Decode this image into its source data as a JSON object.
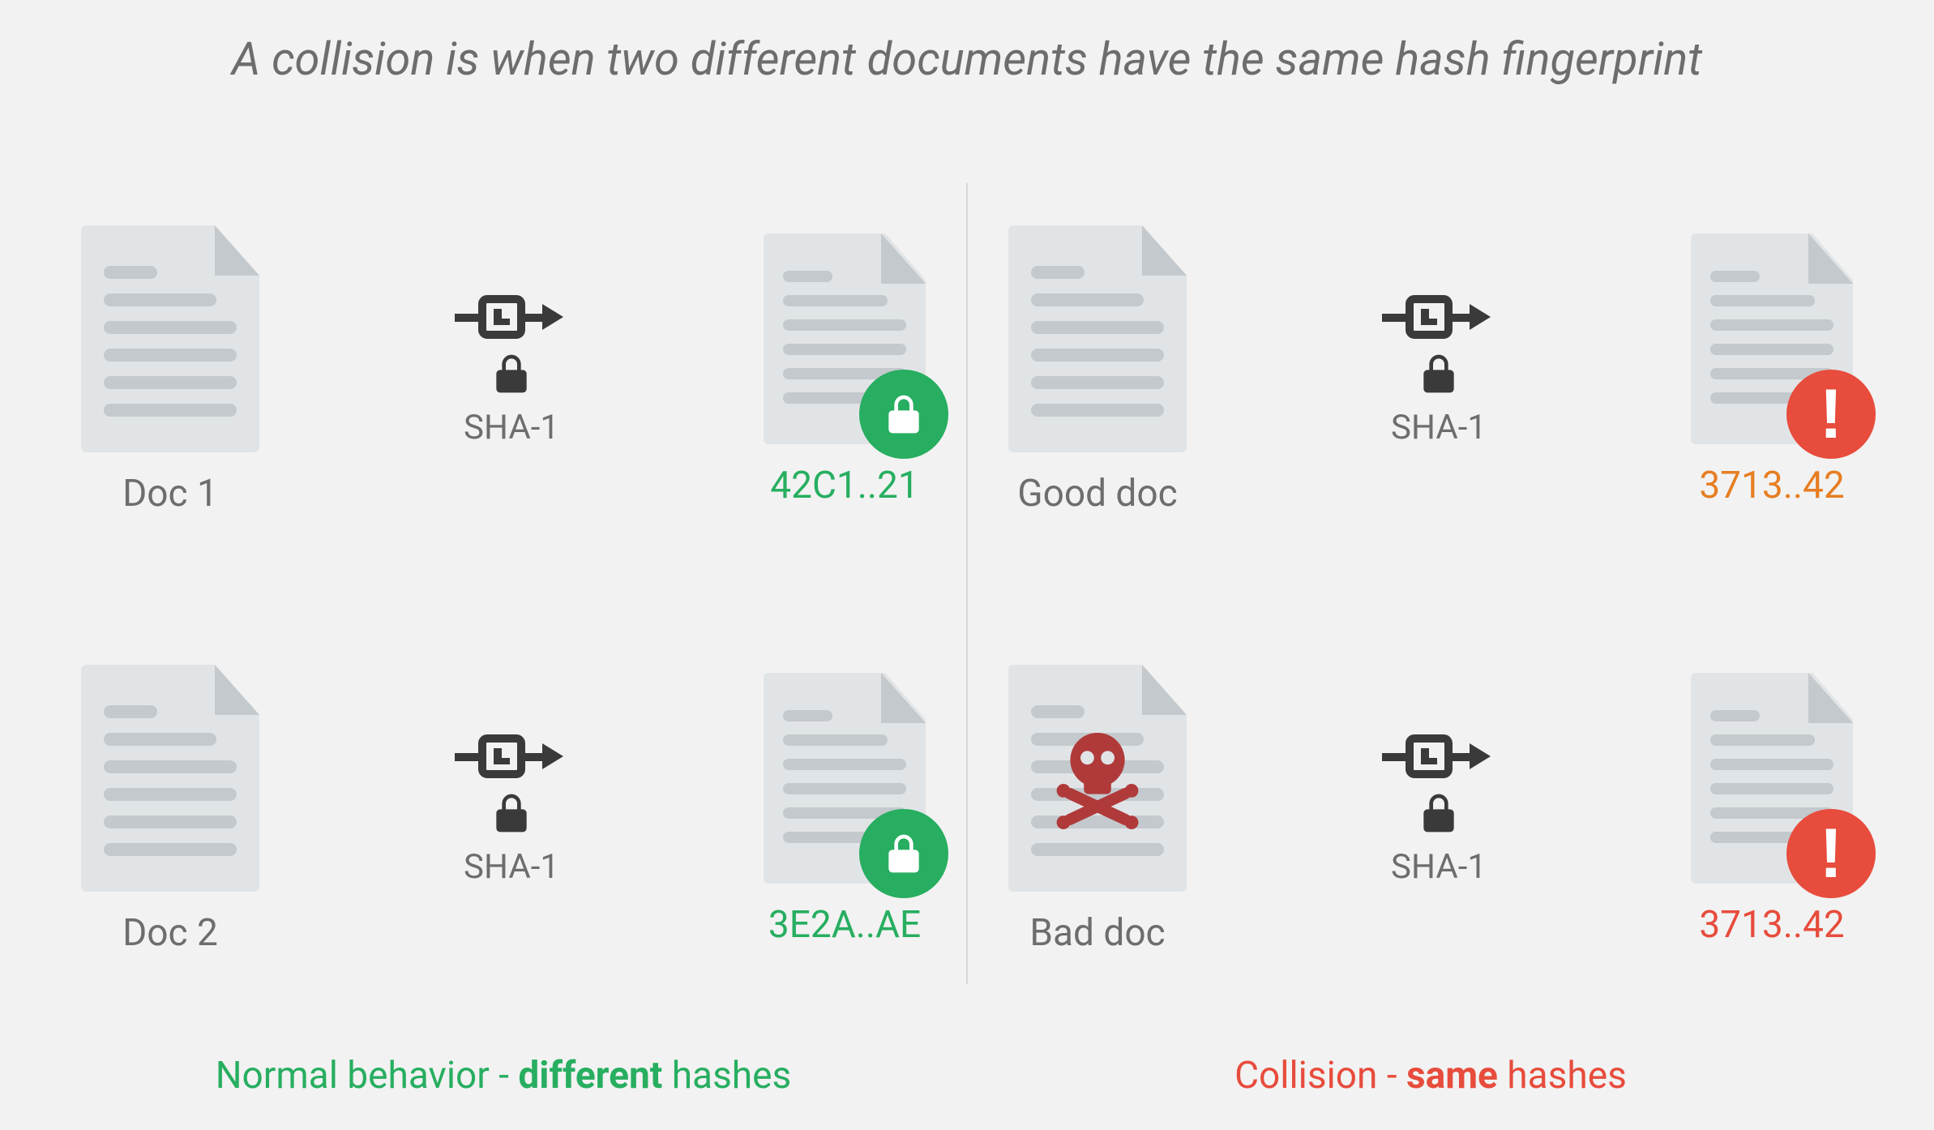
{
  "title": "A collision is when two different documents have the same hash fingerprint",
  "hash_fn_label": "SHA-1",
  "left": {
    "rows": [
      {
        "doc_label": "Doc 1",
        "hash": "42C1..21"
      },
      {
        "doc_label": "Doc 2",
        "hash": "3E2A..AE"
      }
    ],
    "caption_pre": "Normal behavior - ",
    "caption_bold": "different",
    "caption_post": " hashes"
  },
  "right": {
    "rows": [
      {
        "doc_label": "Good doc",
        "hash": "3713..42"
      },
      {
        "doc_label": "Bad doc",
        "hash": "3713..42"
      }
    ],
    "caption_pre": "Collision - ",
    "caption_bold": "same",
    "caption_post": " hashes"
  }
}
